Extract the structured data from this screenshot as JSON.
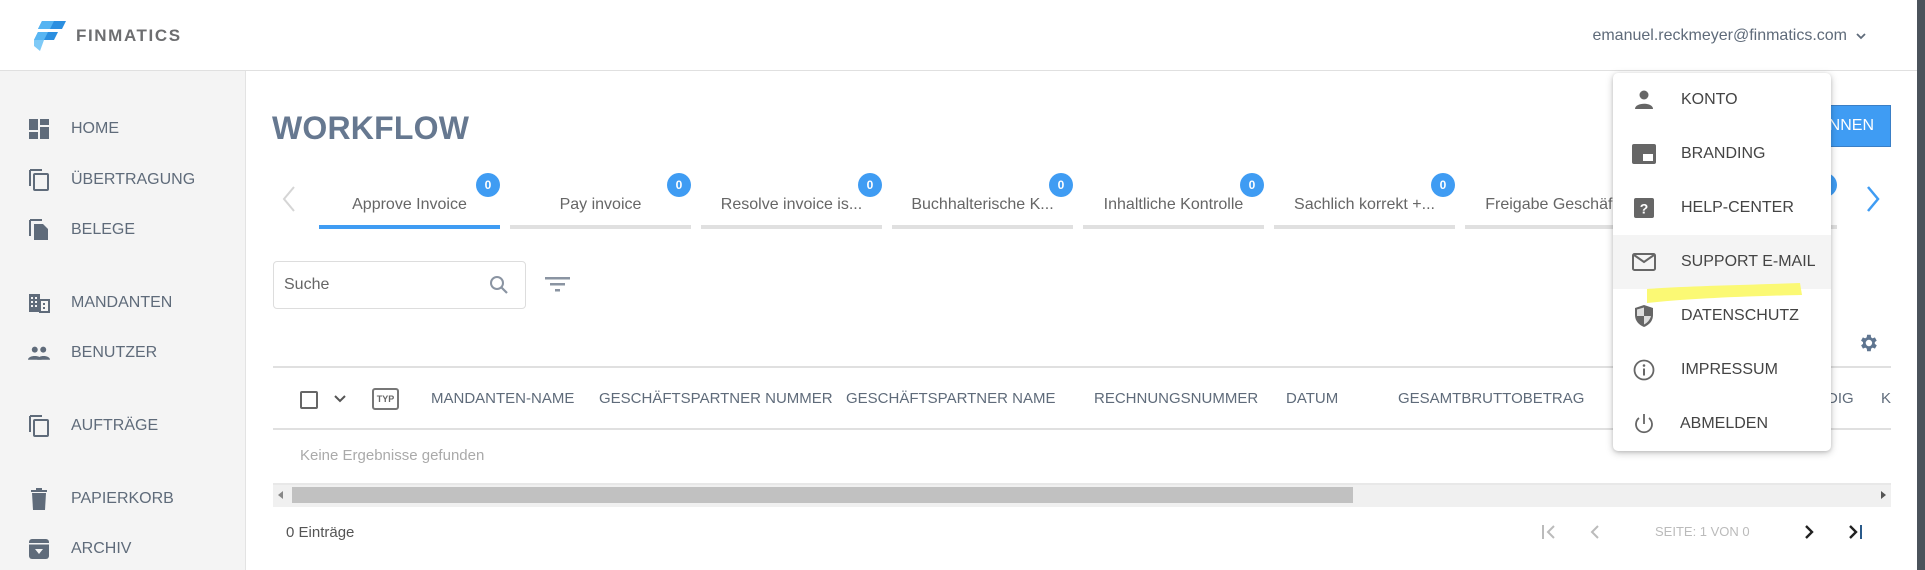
{
  "brand": {
    "name": "FINMATICS"
  },
  "user": {
    "email": "emanuel.reckmeyer@finmatics.com",
    "chevron_icon": "chevron-down-icon"
  },
  "sidebar": {
    "items": [
      {
        "label": "HOME",
        "icon": "dashboard-icon"
      },
      {
        "label": "ÜBERTRAGUNG",
        "icon": "copy-icon"
      },
      {
        "label": "BELEGE",
        "icon": "documents-icon"
      },
      {
        "label": "MANDANTEN",
        "icon": "business-icon"
      },
      {
        "label": "BENUTZER",
        "icon": "people-icon"
      },
      {
        "label": "AUFTRÄGE",
        "icon": "copy-icon"
      },
      {
        "label": "PAPIERKORB",
        "icon": "trash-icon"
      },
      {
        "label": "ARCHIV",
        "icon": "archive-icon"
      }
    ]
  },
  "main": {
    "title": "WORKFLOW",
    "primary_button": "BEGINNEN",
    "tabs": [
      {
        "label": "Approve Invoice",
        "badge": "0",
        "active": true
      },
      {
        "label": "Pay invoice",
        "badge": "0"
      },
      {
        "label": "Resolve invoice is...",
        "badge": "0"
      },
      {
        "label": "Buchhalterische K...",
        "badge": "0"
      },
      {
        "label": "Inhaltliche Kontrolle",
        "badge": "0"
      },
      {
        "label": "Sachlich korrekt +...",
        "badge": "0"
      },
      {
        "label": "Freigabe Geschäf...",
        "badge": ""
      },
      {
        "label": "",
        "badge": "0"
      }
    ],
    "search": {
      "placeholder": "Suche",
      "value": ""
    },
    "table": {
      "type_label": "TYP",
      "columns": [
        "MANDANTEN-NAME",
        "GESCHÄFTSPARTNER NUMMER",
        "GESCHÄFTSPARTNER NAME",
        "RECHNUNGSNUMMER",
        "DATUM",
        "GESAMTBRUTTOBETRAG",
        "ZUSTÄNDIG",
        "K"
      ],
      "empty_message": "Keine Ergebnisse gefunden"
    },
    "footer": {
      "entries": "0 Einträge",
      "page_info": "SEITE: 1 VON 0"
    }
  },
  "dropdown": {
    "items": [
      {
        "label": "KONTO",
        "icon": "person-icon"
      },
      {
        "label": "BRANDING",
        "icon": "branding-icon"
      },
      {
        "label": "HELP-CENTER",
        "icon": "help-icon"
      },
      {
        "label": "SUPPORT E-MAIL",
        "icon": "mail-icon",
        "hovered": true
      },
      {
        "label": "DATENSCHUTZ",
        "icon": "shield-icon"
      },
      {
        "label": "IMPRESSUM",
        "icon": "info-icon"
      },
      {
        "label": "ABMELDEN",
        "icon": "power-icon"
      }
    ]
  },
  "colors": {
    "accent": "#3f9cf3",
    "title": "#667890",
    "text": "#5f6b7a",
    "highlight": "#fafa6e"
  }
}
